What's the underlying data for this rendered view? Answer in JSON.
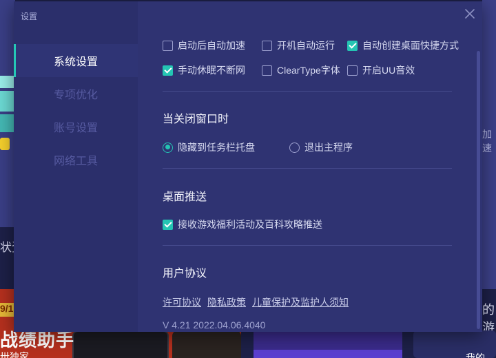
{
  "background": {
    "left_text": "状资",
    "right_text": "加速",
    "right_text2": "的游",
    "banner1_badge": "9/1",
    "banner1_title": "战绩助手",
    "banner1_sub": "卅独家",
    "banner3_text": "我的"
  },
  "dialog": {
    "title": "设置",
    "close_icon": "close-icon"
  },
  "sidebar": {
    "items": [
      {
        "label": "系统设置",
        "active": true
      },
      {
        "label": "专项优化",
        "active": false
      },
      {
        "label": "账号设置",
        "active": false
      },
      {
        "label": "网络工具",
        "active": false
      }
    ]
  },
  "general": {
    "options": [
      {
        "label": "启动后自动加速",
        "checked": false
      },
      {
        "label": "开机自动运行",
        "checked": false
      },
      {
        "label": "自动创建桌面快捷方式",
        "checked": true
      },
      {
        "label": "手动休眠不断网",
        "checked": true
      },
      {
        "label": "ClearType字体",
        "checked": false
      },
      {
        "label": "开启UU音效",
        "checked": false
      }
    ]
  },
  "close_behavior": {
    "title": "当关闭窗口时",
    "options": [
      {
        "label": "隐藏到任务栏托盘",
        "checked": true
      },
      {
        "label": "退出主程序",
        "checked": false
      }
    ]
  },
  "desktop_push": {
    "title": "桌面推送",
    "options": [
      {
        "label": "接收游戏福利活动及百科攻略推送",
        "checked": true
      }
    ]
  },
  "agreement": {
    "title": "用户协议",
    "links": [
      "许可协议",
      "隐私政策",
      "儿童保护及监护人须知"
    ],
    "version": "V 4.21 2022.04.06.4040"
  },
  "colors": {
    "accent": "#24c5b3",
    "dialog_bg": "#2f3372",
    "sidebar_bg": "#2b2f6b"
  }
}
